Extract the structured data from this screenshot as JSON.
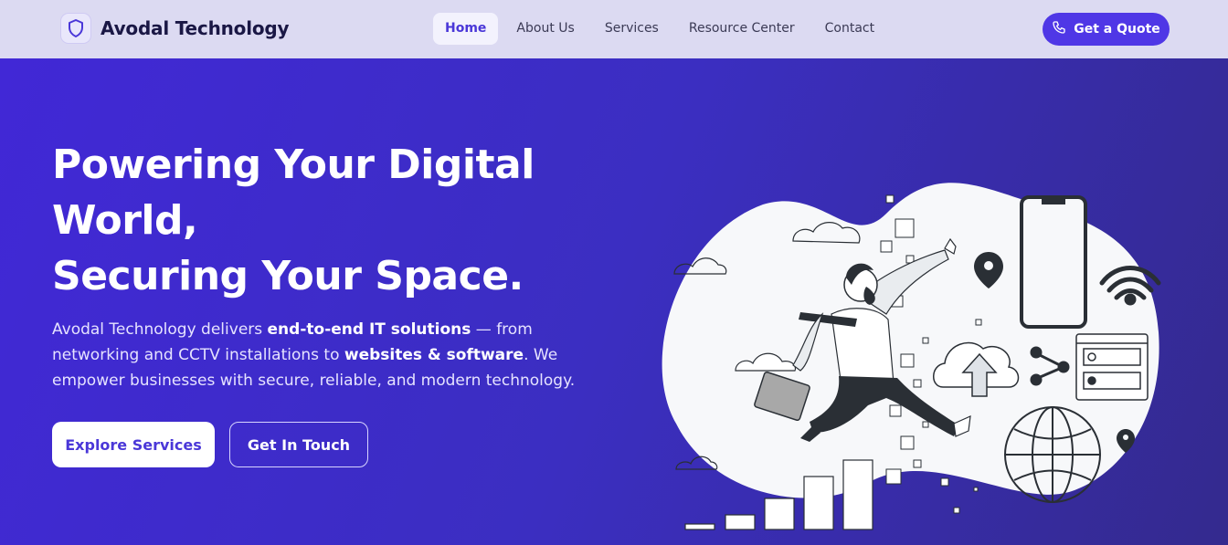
{
  "brand": {
    "name": "Avodal Technology",
    "icon": "shield-icon"
  },
  "nav": {
    "items": [
      {
        "label": "Home",
        "active": true
      },
      {
        "label": "About Us",
        "active": false
      },
      {
        "label": "Services",
        "active": false
      },
      {
        "label": "Resource Center",
        "active": false
      },
      {
        "label": "Contact",
        "active": false
      }
    ],
    "cta": {
      "label": "Get a Quote",
      "icon": "phone-icon"
    }
  },
  "hero": {
    "title_line1": "Powering Your Digital",
    "title_line2": "World,",
    "title_line3": "Securing Your Space.",
    "desc": {
      "p1": "Avodal Technology delivers ",
      "b1": "end-to-end IT solutions",
      "p2": " — from networking and CCTV installations to ",
      "b2": "websites & software",
      "p3": ". We empower businesses with secure, reliable, and modern technology."
    },
    "primary_button": "Explore Services",
    "secondary_button": "Get In Touch"
  },
  "colors": {
    "accent": "#4f37e6",
    "hero_gradient_start": "#4128d6",
    "hero_gradient_end": "#342a8e",
    "nav_bg": "#dcdaf2"
  }
}
